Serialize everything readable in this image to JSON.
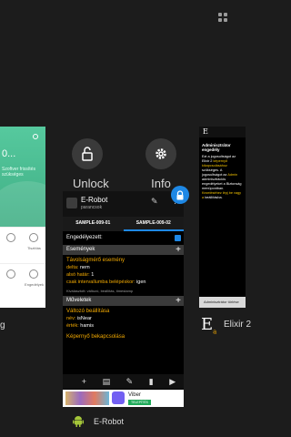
{
  "recents": {
    "left_app_label": "g",
    "left_card": {
      "percent": "0...",
      "caption": "Szoftver frissítés szükséges",
      "cells": [
        "",
        "Tisztítás",
        "",
        "Engedélyek"
      ]
    },
    "controls": {
      "unlock_label": "Unlock",
      "info_label": "Info"
    },
    "main_card": {
      "app_label": "E-Robot",
      "title": "E-Robot",
      "subtitle": "parancsok",
      "tabs": [
        "SAMPLE-009-01",
        "SAMPLE-009-02"
      ],
      "enabled_label": "Engedélyezett:",
      "events_header": "Események",
      "event_name": "Távolságmérő esemény",
      "event_fields": [
        {
          "k": "delta:",
          "v": "nem"
        },
        {
          "k": "alsó határ:",
          "v": "1"
        },
        {
          "k": "csak intervallumba belépéskor:",
          "v": "igen"
        }
      ],
      "event_note": "Kiválasztott: változó, beállítás, timestamp",
      "actions_header": "Műveletek",
      "action_name": "Változó beállítása",
      "action_fields": [
        {
          "k": "név:",
          "v": "isNear"
        },
        {
          "k": "érték:",
          "v": "hamis"
        }
      ],
      "action2_name": "Képernyő bekapcsolása",
      "ad": {
        "name": "Viber",
        "button": "TELEPÍTÉS"
      }
    },
    "right_card": {
      "title": "Adminisztrátor engedély",
      "body_white": "Ezt a jogosultságot az Elixir 2",
      "body_yellow": "képernyő kikapcsolásához",
      "body_white2": "szükséges. A jogosultságot az",
      "body_yellow2": "Admin",
      "body_white3": "adminisztrációs engedélyeket a",
      "body_white4": "Biztonság menüpontban.",
      "body_yellow3": "Kezeléséhez lépj be vagy a",
      "body_white5": "beállításba.",
      "button": "Adminisztrátor törlése",
      "app_label": "Elixir 2"
    }
  }
}
